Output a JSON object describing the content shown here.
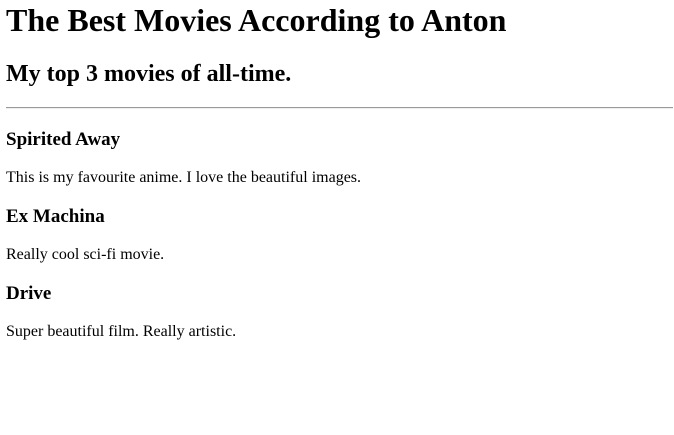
{
  "page": {
    "title": "The Best Movies According to Anton",
    "subtitle": "My top 3 movies of all-time."
  },
  "movies": [
    {
      "title": "Spirited Away",
      "description": "This is my favourite anime. I love the beautiful images."
    },
    {
      "title": "Ex Machina",
      "description": "Really cool sci-fi movie."
    },
    {
      "title": "Drive",
      "description": "Super beautiful film. Really artistic."
    }
  ]
}
